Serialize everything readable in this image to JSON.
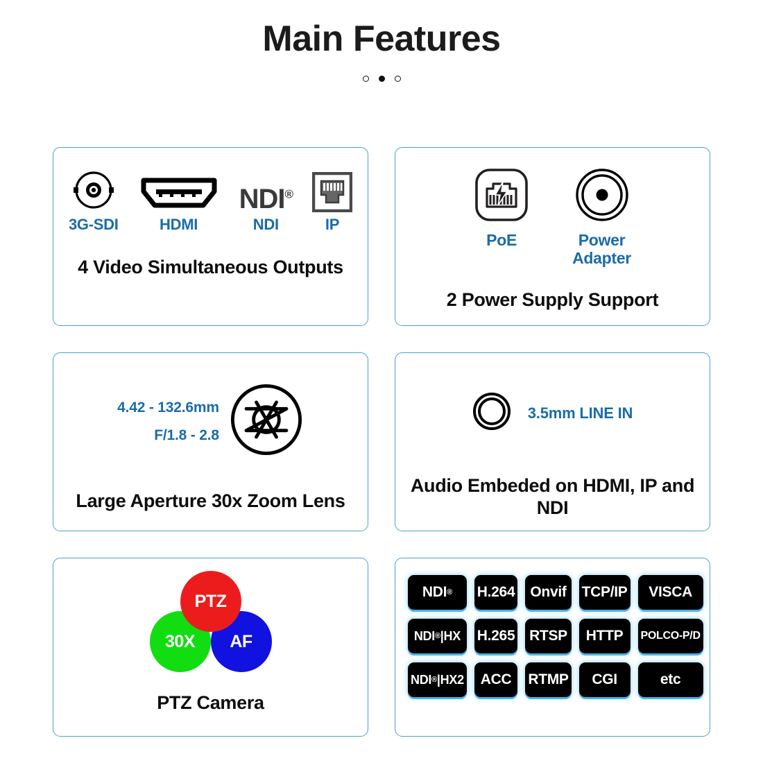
{
  "header": {
    "title": "Main Features",
    "pagination": {
      "total": 3,
      "active_index": 1
    }
  },
  "colors": {
    "accent_blue": "#1a6ca8",
    "card_border": "#4d9fd0",
    "badge_bg": "#000000",
    "badge_glow": "#49b6e8",
    "ptz_red": "#ed1c1c",
    "ptz_green": "#11dd11",
    "ptz_blue": "#1111e0"
  },
  "cards": [
    {
      "id": "video-outputs",
      "title": "4 Video Simultaneous Outputs",
      "icons": [
        {
          "name": "bnc-sdi-icon",
          "label": "3G-SDI"
        },
        {
          "name": "hdmi-port-icon",
          "label": "HDMI"
        },
        {
          "name": "ndi-wordmark-icon",
          "label": "NDI",
          "wordmark": "NDI",
          "wordmark_sup": "®"
        },
        {
          "name": "rj45-ethernet-icon",
          "label": "IP"
        }
      ]
    },
    {
      "id": "power-supply",
      "title": "2 Power Supply Support",
      "icons": [
        {
          "name": "poe-icon",
          "label": "PoE"
        },
        {
          "name": "power-adapter-icon",
          "label_line1": "Power",
          "label_line2": "Adapter"
        }
      ]
    },
    {
      "id": "zoom-lens",
      "title": "Large Aperture 30x Zoom Lens",
      "specs": [
        "4.42 - 132.6mm",
        "F/1.8 - 2.8"
      ],
      "icon": {
        "name": "aperture-iris-icon"
      }
    },
    {
      "id": "audio-embedded",
      "title": "Audio Embeded on HDMI, IP and NDI",
      "icon": {
        "name": "audio-jack-icon",
        "label": "3.5mm LINE IN"
      }
    },
    {
      "id": "ptz-camera",
      "title": "PTZ Camera",
      "venn": [
        {
          "name": "ptz-circle",
          "label": "PTZ"
        },
        {
          "name": "zoom-circle",
          "label": "30X"
        },
        {
          "name": "af-circle",
          "label": "AF"
        }
      ]
    },
    {
      "id": "protocols",
      "badges": [
        {
          "text": "NDI",
          "sup": "®",
          "size": "normal"
        },
        {
          "text": "H.264",
          "size": "normal"
        },
        {
          "text": "Onvif",
          "size": "normal"
        },
        {
          "text": "TCP/IP",
          "size": "normal"
        },
        {
          "text": "VISCA",
          "size": "normal"
        },
        {
          "text": "NDI",
          "sup": "®",
          "suffix": "|HX",
          "size": "md"
        },
        {
          "text": "H.265",
          "size": "normal"
        },
        {
          "text": "RTSP",
          "size": "normal"
        },
        {
          "text": "HTTP",
          "size": "normal"
        },
        {
          "text": "POLCO-P/D",
          "size": "sm"
        },
        {
          "text": "NDI",
          "sup": "®",
          "suffix": "|HX2",
          "size": "md"
        },
        {
          "text": "ACC",
          "size": "normal"
        },
        {
          "text": "RTMP",
          "size": "normal"
        },
        {
          "text": "CGI",
          "size": "normal"
        },
        {
          "text": "etc",
          "size": "normal"
        }
      ]
    }
  ]
}
